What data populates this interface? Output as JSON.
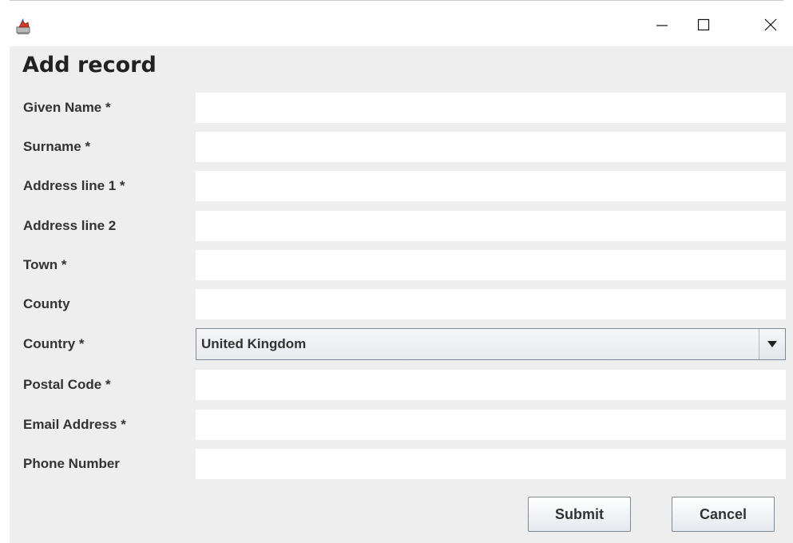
{
  "window": {
    "app_icon": "java-cup-icon",
    "controls": {
      "minimize_icon": "minimize-icon",
      "maximize_icon": "maximize-icon",
      "close_icon": "close-icon"
    }
  },
  "form": {
    "title": "Add record",
    "fields": [
      {
        "key": "given_name",
        "label": "Given Name *",
        "value": ""
      },
      {
        "key": "surname",
        "label": "Surname *",
        "value": ""
      },
      {
        "key": "address_line_1",
        "label": "Address line 1 *",
        "value": ""
      },
      {
        "key": "address_line_2",
        "label": "Address line 2",
        "value": ""
      },
      {
        "key": "town",
        "label": "Town *",
        "value": ""
      },
      {
        "key": "county",
        "label": "County",
        "value": ""
      },
      {
        "key": "country",
        "label": "Country *",
        "value": "United Kingdom"
      },
      {
        "key": "postal_code",
        "label": "Postal Code *",
        "value": ""
      },
      {
        "key": "email_address",
        "label": "Email Address *",
        "value": ""
      },
      {
        "key": "phone_number",
        "label": "Phone Number",
        "value": ""
      }
    ],
    "country_dropdown_icon": "triangle-down-icon"
  },
  "buttons": {
    "submit": "Submit",
    "cancel": "Cancel"
  },
  "colors": {
    "panel_background": "#eeeeee",
    "field_background": "#ffffff",
    "text": "#333333"
  }
}
